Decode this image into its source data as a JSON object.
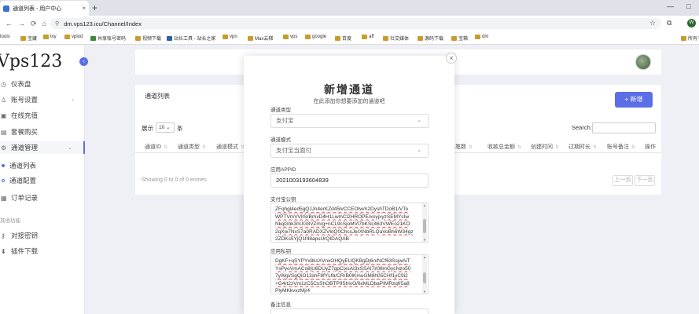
{
  "browser": {
    "tab_title": "通道列表 - 用户中心",
    "tab_close": "×",
    "new_tab": "+",
    "win_min": "—",
    "win_max": "□",
    "url": "dm.vps123.icu/Channel/Index",
    "profile_initial": "W",
    "nav": {
      "back": "←",
      "forward": "→",
      "reload": "⟳",
      "home": "⌂"
    },
    "bookmarks": [
      "tools",
      "宝藏",
      "txy",
      "vplod",
      "共享账号密码",
      "视频下载",
      "站长工具 - 站长之家",
      "vpn",
      "Max云梯",
      "vps",
      "google",
      "百度",
      "aff",
      "社交媒体",
      "源码下载",
      "宝箱",
      "dm",
      "所有书签"
    ]
  },
  "sidebar": {
    "logo": "Vps123",
    "collapse_icon": "‹",
    "items": [
      {
        "icon": "◷",
        "label": "仪表盘"
      },
      {
        "icon": "♙",
        "label": "账号设置",
        "arrow": "›"
      },
      {
        "icon": "▣",
        "label": "在线充值"
      },
      {
        "icon": "▤",
        "label": "套餐购买"
      },
      {
        "icon": "⚙",
        "label": "通道管理",
        "arrow": "⌄"
      }
    ],
    "subitems": [
      {
        "label": "通道列表"
      },
      {
        "label": "通道配置"
      }
    ],
    "items2": [
      {
        "icon": "▦",
        "label": "订单记录"
      }
    ],
    "group_label": "其他功能",
    "items3": [
      {
        "icon": "⚷",
        "label": "对接密钥"
      },
      {
        "icon": "⬇",
        "label": "插件下载"
      }
    ]
  },
  "main": {
    "card_title": "通道列表",
    "add_button": "+ 新增",
    "show_label": "展示",
    "show_value": "10",
    "entries_label": "条",
    "search_label": "Search:",
    "columns": [
      "通道ID",
      "通道类型",
      "通道模式",
      "总笔数",
      "收款总金额",
      "创建时间",
      "过期时长",
      "账号备注",
      "操作"
    ],
    "info": "Showing 0 to 0 of 0 entries",
    "prev": "上一页",
    "next": "下一页"
  },
  "modal": {
    "close": "×",
    "title": "新增通道",
    "subtitle": "在此添加你想要添加的通道吧",
    "fields": {
      "type_label": "通道类型",
      "type_value": "支付宝",
      "mode_label": "通道模式",
      "mode_value": "支付宝当面付",
      "appid_label": "应用APPID",
      "appid_value": "2021003193604839",
      "pubkey_label": "支付宝公钥",
      "pubkey_lines": [
        "ZFqhgl4ed5gQJJn4erKZd45lvCCEOIw/n2DyshTDoB1/VTo",
        "WPTVmVVlISrBmxD4H1LwmCl2HROPE/xoyjxyzSEMYcIw",
        "NkqGbk3nUG8VZm/g+nCL9cSjoMVl7bKSc463VWEo21KO",
        "2qXw7NxS7a0RADXZVkIQ0ChcsJeIXNbRLQaVoBh6W34gz",
        "2ZDKs5YjQ1f48apsUrQIDAQAB"
      ],
      "privkey_label": "应用私钥",
      "privkey_lines": [
        "DgKF+qSYPYx8ksXVnxOHQyEUQKBgDj6n/NCf63SsjwAiT",
        "YsPyoVmACo8jU6DUyZ7gpCixsAI3xSSAI7z08mGycNzo50",
        "7yWgi/SgQiO13shF8fYLfb/CRrB0lKmuGM8h05CHf1yC9i2",
        "+G4rt2zVm1zC5CsShOBTP9ShivO/6xMLDbaPIMRzqfr5a8",
        "PlyMKkvxzMj/4"
      ],
      "remark_label": "备注信息"
    }
  }
}
